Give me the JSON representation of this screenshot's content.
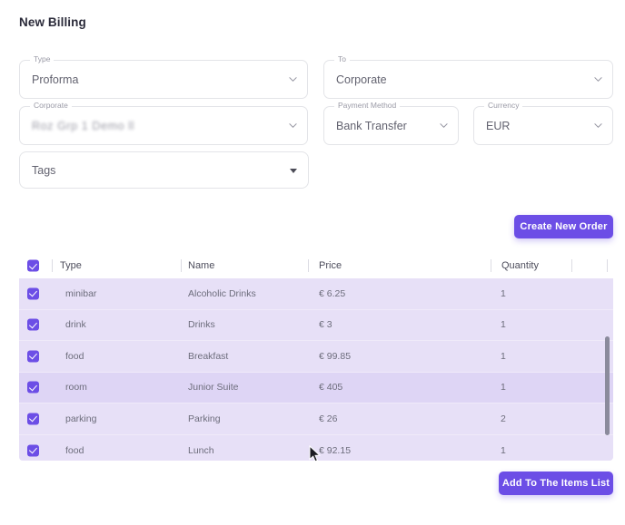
{
  "page": {
    "title": "New Billing"
  },
  "form": {
    "type": {
      "label": "Type",
      "value": "Proforma",
      "icon": "chevron-down-icon"
    },
    "to": {
      "label": "To",
      "value": "Corporate",
      "icon": "chevron-down-icon"
    },
    "corporate": {
      "label": "Corporate",
      "value": "Roz Grp 1 Demo ll",
      "redacted": true,
      "icon": "chevron-down-icon"
    },
    "payment_method": {
      "label": "Payment Method",
      "value": "Bank Transfer",
      "icon": "chevron-down-icon"
    },
    "currency": {
      "label": "Currency",
      "value": "EUR",
      "icon": "chevron-down-icon"
    },
    "tags": {
      "label": "",
      "placeholder": "Tags",
      "value": "Tags",
      "icon": "caret-down-icon"
    }
  },
  "actions": {
    "create_new_order": "Create New Order",
    "add_to_items_list": "Add To The Items List"
  },
  "table": {
    "select_all_checked": true,
    "columns": [
      "Type",
      "Name",
      "Price",
      "Quantity"
    ],
    "rows": [
      {
        "checked": true,
        "type": "minibar",
        "name": "Alcoholic Drinks",
        "price": "€ 6.25",
        "quantity": "1",
        "highlighted": false
      },
      {
        "checked": true,
        "type": "drink",
        "name": "Drinks",
        "price": "€ 3",
        "quantity": "1",
        "highlighted": false
      },
      {
        "checked": true,
        "type": "food",
        "name": "Breakfast",
        "price": "€ 99.85",
        "quantity": "1",
        "highlighted": false
      },
      {
        "checked": true,
        "type": "room",
        "name": "Junior Suite",
        "price": "€ 405",
        "quantity": "1",
        "highlighted": true
      },
      {
        "checked": true,
        "type": "parking",
        "name": "Parking",
        "price": "€ 26",
        "quantity": "2",
        "highlighted": false
      },
      {
        "checked": true,
        "type": "food",
        "name": "Lunch",
        "price": "€ 92.15",
        "quantity": "1",
        "highlighted": false
      }
    ]
  },
  "colors": {
    "accent": "#6c4ee6",
    "row_bg": "#e7e0f7",
    "row_bg_highlight": "#ded5f5",
    "page_bg": "#ffffff",
    "border": "#e3e4e8"
  }
}
